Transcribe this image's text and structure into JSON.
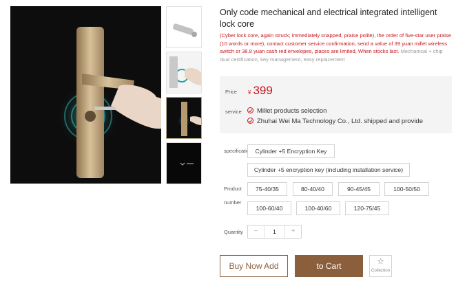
{
  "product": {
    "title": "Only code mechanical and electrical integrated intelligent lock core",
    "promo_red": "(Cyber lock core, again struck; immediately snapped, praise polite), the order of five-star user praise (10 words or more), contact customer service confirmation, send a value of 39 yuan millet wireless switch or 38.8 yuan cash red envelopes, places are limited, When stocks last.",
    "promo_grey": "Mechanical + chip dual certification, key management, easy replacement"
  },
  "price": {
    "label": "Price",
    "currency": "¥",
    "value": "399"
  },
  "service": {
    "label": "service",
    "items": [
      "Millet products selection",
      "Zhuhai Wei Ma Technology Co., Ltd. shipped and provide"
    ]
  },
  "specification": {
    "label": "specification",
    "options": [
      "Cylinder +5 Encryption Key",
      "Cylinder +5 encryption key (including installation service)"
    ]
  },
  "product_number": {
    "label_line1": "Product",
    "label_line2": "number",
    "options": [
      "75-40/35",
      "80-40/40",
      "90-45/45",
      "100-50/50",
      "100-60/40",
      "100-40/60",
      "120-75/45"
    ]
  },
  "quantity": {
    "label": "Quantity",
    "minus": "−",
    "value": "1",
    "plus": "+"
  },
  "actions": {
    "buy_now": "Buy Now Add",
    "to_cart": "to Cart",
    "collection": "Collection"
  },
  "colors": {
    "accent": "#c8161d",
    "brand": "#8b5e3c"
  },
  "icons": {
    "check": "check-circle-icon",
    "star": "star-outline-icon"
  }
}
